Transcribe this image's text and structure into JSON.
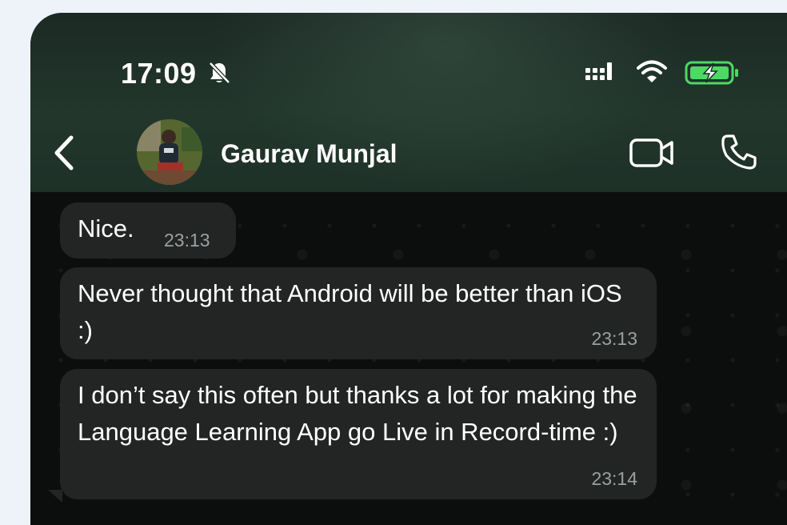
{
  "status_bar": {
    "time": "17:09",
    "icons": [
      "bell-slash-icon",
      "signal-icon",
      "wifi-icon",
      "battery-charging-icon"
    ],
    "battery_color": "#4cd964"
  },
  "header": {
    "contact_name": "Gaurav Munjal",
    "icons": [
      "chevron-left-icon",
      "avatar",
      "video-call-icon",
      "phone-call-icon"
    ]
  },
  "messages": [
    {
      "text": "Nice.",
      "time": "23:13"
    },
    {
      "text": "Never thought that Android will be better than iOS :)",
      "time": "23:13"
    },
    {
      "text": "I don’t say this often but thanks a lot for making the Language Learning App go Live in Record-time :)",
      "time": "23:14"
    }
  ],
  "colors": {
    "page_background": "#eef3fa",
    "header_background": "#22362c",
    "chat_background": "#0c0e0e",
    "bubble_background": "#232525",
    "timestamp": "#9aa0a0"
  }
}
